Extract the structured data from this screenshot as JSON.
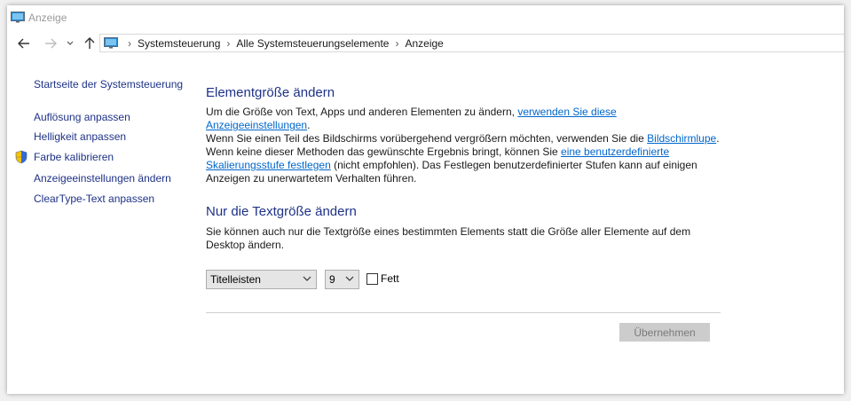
{
  "window": {
    "title": "Anzeige"
  },
  "nav": {
    "breadcrumbs": [
      "Systemsteuerung",
      "Alle Systemsteuerungselemente",
      "Anzeige"
    ]
  },
  "sidebar": {
    "home": "Startseite der Systemsteuerung",
    "items": [
      {
        "label": "Auflösung anpassen"
      },
      {
        "label": "Helligkeit anpassen"
      },
      {
        "label": "Farbe kalibrieren"
      },
      {
        "label": "Anzeigeeinstellungen ändern"
      },
      {
        "label": "ClearType-Text anpassen"
      }
    ]
  },
  "section1": {
    "heading": "Elementgröße ändern",
    "text_a": "Um die Größe von Text, Apps und anderen Elementen zu ändern, ",
    "link_a": "verwenden Sie diese Anzeigeeinstellungen",
    "text_b": ".",
    "text_c": "Wenn Sie einen Teil des Bildschirms vorübergehend vergrößern möchten, verwenden Sie die ",
    "link_b": "Bildschirmlupe",
    "text_d": ".",
    "text_e": "Wenn keine dieser Methoden das gewünschte Ergebnis bringt, können Sie ",
    "link_c": "eine benutzerdefinierte Skalierungsstufe festlegen",
    "text_f": " (nicht empfohlen). Das Festlegen benutzerdefinierter Stufen kann auf einigen Anzeigen zu unerwartetem Verhalten führen."
  },
  "section2": {
    "heading": "Nur die Textgröße ändern",
    "text": "Sie können auch nur die Textgröße eines bestimmten Elements statt die Größe aller Elemente auf dem Desktop ändern.",
    "element_select": "Titelleisten",
    "size_select": "9",
    "bold_label": "Fett",
    "bold_checked": false
  },
  "apply_button": "Übernehmen",
  "colors": {
    "link": "#0066cc",
    "heading": "#1e3287",
    "disabled_button": "#cccccc"
  }
}
